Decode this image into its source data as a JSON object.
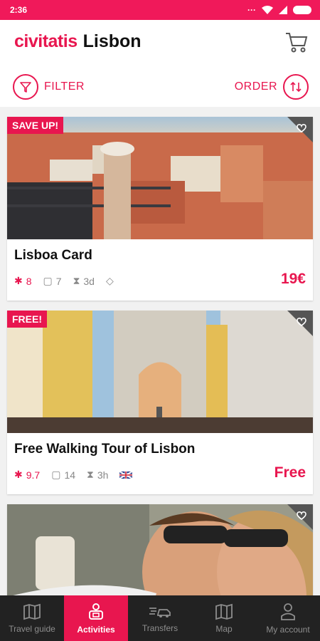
{
  "status": {
    "time": "2:36"
  },
  "header": {
    "brand": "civitatis",
    "city": "Lisbon"
  },
  "controls": {
    "filter_label": "FILTER",
    "order_label": "ORDER"
  },
  "cards": [
    {
      "badge": "SAVE UP!",
      "title": "Lisboa Card",
      "rating": "8",
      "comments": "7",
      "duration": "3d",
      "price": "19€"
    },
    {
      "badge": "FREE!",
      "title": "Free Walking Tour of Lisbon",
      "rating": "9.7",
      "comments": "14",
      "duration": "3h",
      "price": "Free"
    }
  ],
  "tabs": [
    {
      "label": "Travel guide",
      "icon": "map-book-icon"
    },
    {
      "label": "Activities",
      "icon": "activities-icon",
      "active": true
    },
    {
      "label": "Transfers",
      "icon": "transfer-car-icon"
    },
    {
      "label": "Map",
      "icon": "map-icon"
    },
    {
      "label": "My account",
      "icon": "account-icon"
    }
  ],
  "colors": {
    "brand": "#e8164f",
    "statusbar": "#f0195a",
    "tabbar": "#222222"
  }
}
